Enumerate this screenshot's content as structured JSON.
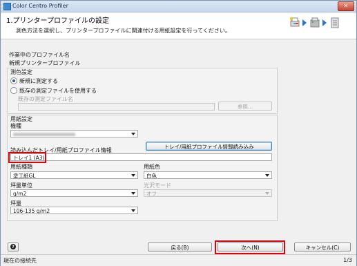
{
  "window": {
    "title": "Color Centro Profiler",
    "close_label": "✕"
  },
  "header": {
    "step_title": "1.プリンタープロファイルの設定",
    "description": "測色方法を選択し、プリンタープロファイルに関連付ける用紙設定を行ってください。",
    "wizard_icons": [
      "printer-wizard-icon",
      "scanner-icon",
      "paper-tray-icon"
    ]
  },
  "working_profile": {
    "label": "作業中のプロファイル名",
    "value": "新規プリンタープロファイル"
  },
  "measurement": {
    "section_label": "測色設定",
    "option_new": "新規に測定する",
    "option_existing": "既存の測定ファイルを使用する",
    "selected": "option_new",
    "existing_file_label": "既存の測定ファイル名",
    "existing_file_value": "",
    "browse_button": "参照..."
  },
  "paper": {
    "section_label": "用紙設定",
    "model_label": "機種",
    "load_button": "トレイ/用紙プロファイル情報読み込み",
    "loaded_info_label": "読み込んだトレイ/用紙プロファイル情報",
    "loaded_info_value": "トレイ1 (A3)",
    "paper_type_label": "用紙種類",
    "paper_type_value": "塗工紙GL",
    "paper_color_label": "用紙色",
    "paper_color_value": "白色",
    "weight_unit_label": "坪量単位",
    "weight_unit_value": "g/m2",
    "gloss_mode_label": "光沢モード",
    "gloss_mode_value": "オフ",
    "weight_label": "坪量",
    "weight_value": "106-135 g/m2"
  },
  "footer": {
    "help_label": "?",
    "back_button": "戻る(B)",
    "next_button": "次へ(N)",
    "cancel_button": "キャンセル(C)"
  },
  "status": {
    "connection_label": "現在の接続先",
    "page_indicator": "1/3"
  },
  "colors": {
    "accent": "#2f73c9",
    "highlight": "#e0000b"
  }
}
